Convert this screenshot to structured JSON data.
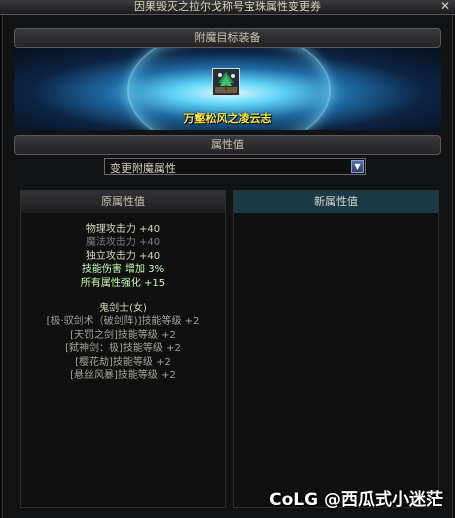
{
  "window": {
    "title": "因果毁灭之拉尔戈称号宝珠属性变更券",
    "close_glyph": "✕"
  },
  "target_section": {
    "header": "附魔目标装备",
    "item_name": "万壑松风之凌云志",
    "item_icon": "tree-landscape-icon"
  },
  "attribute_section": {
    "header": "属性值",
    "select": {
      "value": "变更附魔属性",
      "arrow_icon": "chevron-down-icon"
    }
  },
  "original_panel": {
    "header": "原属性值",
    "stats": [
      {
        "text": "物理攻击力 +40",
        "style": "g"
      },
      {
        "text": "魔法攻击力 +40",
        "style": "dim"
      },
      {
        "text": "独立攻击力 +40",
        "style": "g"
      },
      {
        "text": "技能伤害 增加 3%",
        "style": "green"
      },
      {
        "text": "所有属性强化 +15",
        "style": "green"
      }
    ],
    "class_name": "鬼剑士(女)",
    "skills": [
      "[极·驭剑术（破剑阵)]技能等级 +2",
      "[天罚之剑]技能等级 +2",
      "[弑神剑：极]技能等级 +2",
      "[樱花劫]技能等级 +2",
      "[悬丝风暴]技能等级 +2"
    ]
  },
  "new_panel": {
    "header": "新属性值"
  },
  "watermark": "CoLG @西瓜式小迷茫",
  "colors": {
    "item_name": "#ffe63a",
    "glow": "#5fd3f7",
    "new_header_bg": "#1a3a45"
  }
}
